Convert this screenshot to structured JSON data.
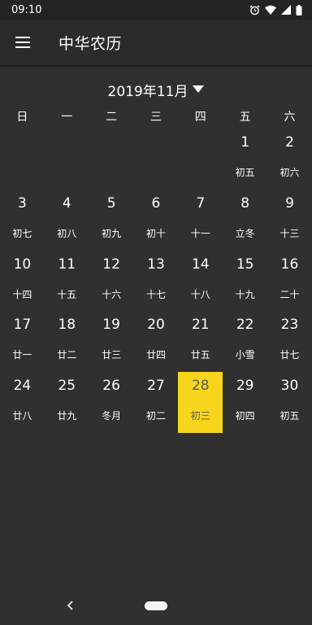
{
  "status_bar": {
    "time": "09:10"
  },
  "app_bar": {
    "title": "中华农历",
    "menu_icon": "hamburger-menu-icon"
  },
  "calendar": {
    "month_label": "2019年11月",
    "weekdays": [
      "日",
      "一",
      "二",
      "三",
      "四",
      "五",
      "六"
    ],
    "days": [
      {
        "num": "",
        "lunar": ""
      },
      {
        "num": "",
        "lunar": ""
      },
      {
        "num": "",
        "lunar": ""
      },
      {
        "num": "",
        "lunar": ""
      },
      {
        "num": "",
        "lunar": ""
      },
      {
        "num": "1",
        "lunar": "初五"
      },
      {
        "num": "2",
        "lunar": "初六"
      },
      {
        "num": "3",
        "lunar": "初七"
      },
      {
        "num": "4",
        "lunar": "初八"
      },
      {
        "num": "5",
        "lunar": "初九"
      },
      {
        "num": "6",
        "lunar": "初十"
      },
      {
        "num": "7",
        "lunar": "十一"
      },
      {
        "num": "8",
        "lunar": "立冬"
      },
      {
        "num": "9",
        "lunar": "十三"
      },
      {
        "num": "10",
        "lunar": "十四"
      },
      {
        "num": "11",
        "lunar": "十五"
      },
      {
        "num": "12",
        "lunar": "十六"
      },
      {
        "num": "13",
        "lunar": "十七"
      },
      {
        "num": "14",
        "lunar": "十八"
      },
      {
        "num": "15",
        "lunar": "十九"
      },
      {
        "num": "16",
        "lunar": "二十"
      },
      {
        "num": "17",
        "lunar": "廿一"
      },
      {
        "num": "18",
        "lunar": "廿二"
      },
      {
        "num": "19",
        "lunar": "廿三"
      },
      {
        "num": "20",
        "lunar": "廿四"
      },
      {
        "num": "21",
        "lunar": "廿五"
      },
      {
        "num": "22",
        "lunar": "小雪"
      },
      {
        "num": "23",
        "lunar": "廿七"
      },
      {
        "num": "24",
        "lunar": "廿八"
      },
      {
        "num": "25",
        "lunar": "廿九"
      },
      {
        "num": "26",
        "lunar": "冬月"
      },
      {
        "num": "27",
        "lunar": "初二"
      },
      {
        "num": "28",
        "lunar": "初三",
        "selected": true
      },
      {
        "num": "29",
        "lunar": "初四"
      },
      {
        "num": "30",
        "lunar": "初五"
      }
    ]
  },
  "colors": {
    "background": "#303030",
    "app_bar": "#2b2b2b",
    "selected": "#f7d51d"
  }
}
